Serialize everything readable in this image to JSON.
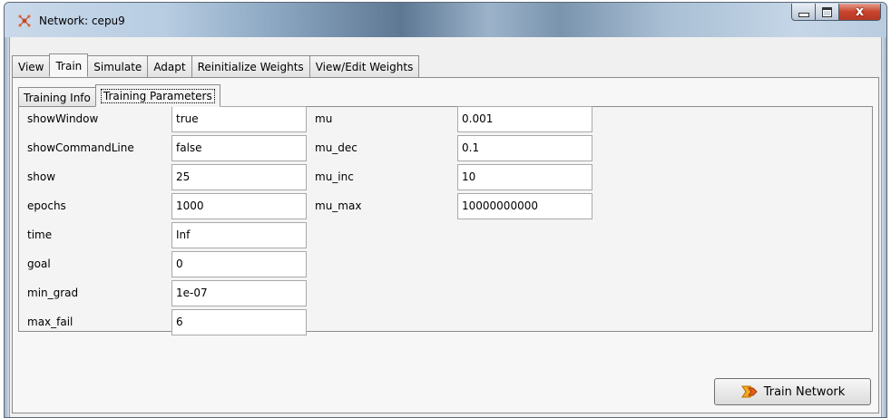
{
  "window": {
    "title": "Network: cepu9",
    "controls": {
      "minimize": "_",
      "maximize": "□",
      "close": "x"
    }
  },
  "tabs": [
    {
      "label": "View",
      "active": false
    },
    {
      "label": "Train",
      "active": true
    },
    {
      "label": "Simulate",
      "active": false
    },
    {
      "label": "Adapt",
      "active": false
    },
    {
      "label": "Reinitialize Weights",
      "active": false
    },
    {
      "label": "View/Edit Weights",
      "active": false
    }
  ],
  "subtabs": [
    {
      "label": "Training Info",
      "active": false
    },
    {
      "label": "Training Parameters",
      "active": true
    }
  ],
  "params_left": [
    {
      "name": "showWindow",
      "value": "true"
    },
    {
      "name": "showCommandLine",
      "value": "false"
    },
    {
      "name": "show",
      "value": "25"
    },
    {
      "name": "epochs",
      "value": "1000"
    },
    {
      "name": "time",
      "value": "Inf"
    },
    {
      "name": "goal",
      "value": "0"
    },
    {
      "name": "min_grad",
      "value": "1e-07"
    },
    {
      "name": "max_fail",
      "value": "6"
    }
  ],
  "params_right": [
    {
      "name": "mu",
      "value": "0.001"
    },
    {
      "name": "mu_dec",
      "value": "0.1"
    },
    {
      "name": "mu_inc",
      "value": "10"
    },
    {
      "name": "mu_max",
      "value": "10000000000"
    }
  ],
  "train_button": {
    "label": "Train Network",
    "icon": "train-icon"
  },
  "colors": {
    "accent_icon": "#f5a623",
    "close_button": "#c8432c"
  }
}
